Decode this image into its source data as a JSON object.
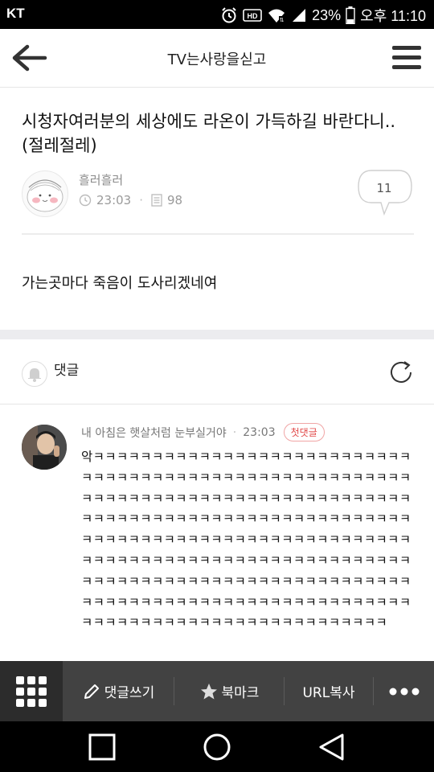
{
  "status_bar": {
    "carrier": "KT",
    "battery": "23%",
    "time": "오후 11:10",
    "icons": [
      "alarm-icon",
      "hd-icon",
      "wifi-icon",
      "signal-icon",
      "battery-icon"
    ]
  },
  "app_bar": {
    "title": "TV는사랑을싣고",
    "back_icon": "back-arrow-icon",
    "menu_icon": "hamburger-icon"
  },
  "post": {
    "title": "시청자여러분의 세상에도 라온이 가득하길 바란다니.. (절레절레)",
    "author": "흘러흘러",
    "time": "23:03",
    "views": "98",
    "comment_count": "11",
    "body": "가는곳마다 죽음이 도사리겠네여"
  },
  "comments_section": {
    "label": "댓글"
  },
  "comment": {
    "author": "내 아침은 햇살처럼 눈부실거야",
    "time": "23:03",
    "badge": "첫댓글",
    "text": "악ㅋㅋㅋㅋㅋㅋㅋㅋㅋㅋㅋㅋㅋㅋㅋㅋㅋㅋㅋㅋㅋㅋㅋㅋㅋㅋㅋㅋㅋㅋㅋㅋㅋㅋㅋㅋㅋㅋㅋㅋㅋㅋㅋㅋㅋㅋㅋㅋㅋㅋㅋㅋㅋㅋㅋㅋㅋㅋㅋㅋㅋㅋㅋㅋㅋㅋㅋㅋㅋㅋㅋㅋㅋㅋㅋㅋㅋㅋㅋㅋㅋㅋㅋㅋㅋㅋㅋㅋㅋㅋㅋㅋㅋㅋㅋㅋㅋㅋㅋㅋㅋㅋㅋㅋㅋㅋㅋㅋㅋㅋㅋㅋㅋㅋㅋㅋㅋㅋㅋㅋㅋㅋㅋㅋㅋㅋㅋㅋㅋㅋㅋㅋㅋㅋㅋㅋㅋㅋㅋㅋㅋㅋㅋㅋㅋㅋㅋㅋㅋㅋㅋㅋㅋㅋㅋㅋㅋㅋㅋㅋㅋㅋㅋㅋㅋㅋㅋㅋㅋㅋㅋㅋㅋㅋㅋㅋㅋㅋㅋㅋㅋㅋㅋㅋㅋㅋㅋㅋㅋㅋㅋㅋㅋㅋㅋㅋㅋㅋㅋㅋㅋㅋㅋㅋㅋㅋㅋㅋㅋㅋㅋㅋㅋㅋㅋㅋㅋㅋㅋㅋㅋㅋㅋㅋㅋㅋㅋㅋㅋㅋㅋㅋㅋㅋㅋㅋㅋㅋㅋㅋㅋㅋㅋㅋㅋㅋㅋㅋㅋ"
  },
  "bottom_bar": {
    "grid_icon": "grid-menu-icon",
    "write_comment": "댓글쓰기",
    "bookmark": "북마크",
    "copy_url": "URL복사",
    "more_icon": "more-dots-icon"
  },
  "nav_bar": {
    "icons": [
      "recent-apps-icon",
      "home-icon",
      "back-triangle-icon"
    ]
  },
  "colors": {
    "badge_red": "#e24b4b",
    "bottom_bar": "#424242",
    "section_gap": "#ececef"
  }
}
